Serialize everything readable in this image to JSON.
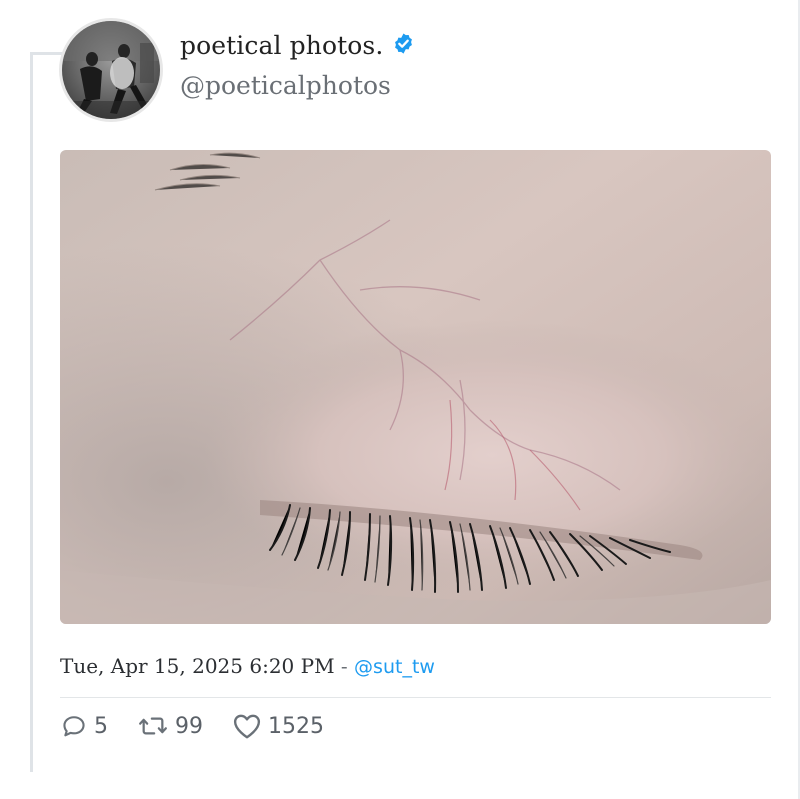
{
  "profile": {
    "display_name": "poetical photos.",
    "handle": "@poeticalphotos",
    "verified_icon": "verified-badge-icon",
    "avatar_icon": "black-and-white-photo-avatar"
  },
  "tweet": {
    "timestamp": "Tue, Apr 15, 2025 6:20 PM",
    "separator": " - ",
    "mention": "@sut_tw",
    "photo_subject": "close-up photo of a closed eye"
  },
  "stats": {
    "replies": "5",
    "retweets": "99",
    "likes": "1525"
  },
  "colors": {
    "verified": "#1d9bf0",
    "mention": "#1d9bf0",
    "icon": "#6a7178"
  }
}
